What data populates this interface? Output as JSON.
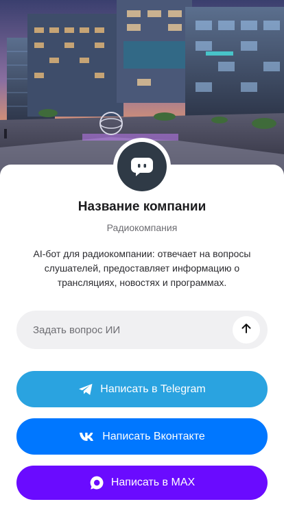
{
  "profile": {
    "name": "Название компании",
    "category": "Радиокомпания",
    "description": "AI-бот для радиокомпании: отвечает на вопросы слушателей, предоставляет информацию о трансляциях, новостях и программах."
  },
  "ask": {
    "placeholder": "Задать вопрос ИИ",
    "value": ""
  },
  "buttons": {
    "telegram": "Написать в Telegram",
    "vk": "Написать Вконтакте",
    "max": "Написать в MAX"
  },
  "colors": {
    "telegram": "#2aa3e0",
    "vk": "#0077ff",
    "max": "#6a0bff",
    "avatar": "#2f3a46"
  },
  "icons": {
    "avatar": "chat-bot-icon",
    "send": "arrow-up-icon",
    "telegram": "telegram-icon",
    "vk": "vk-icon",
    "max": "max-icon"
  }
}
